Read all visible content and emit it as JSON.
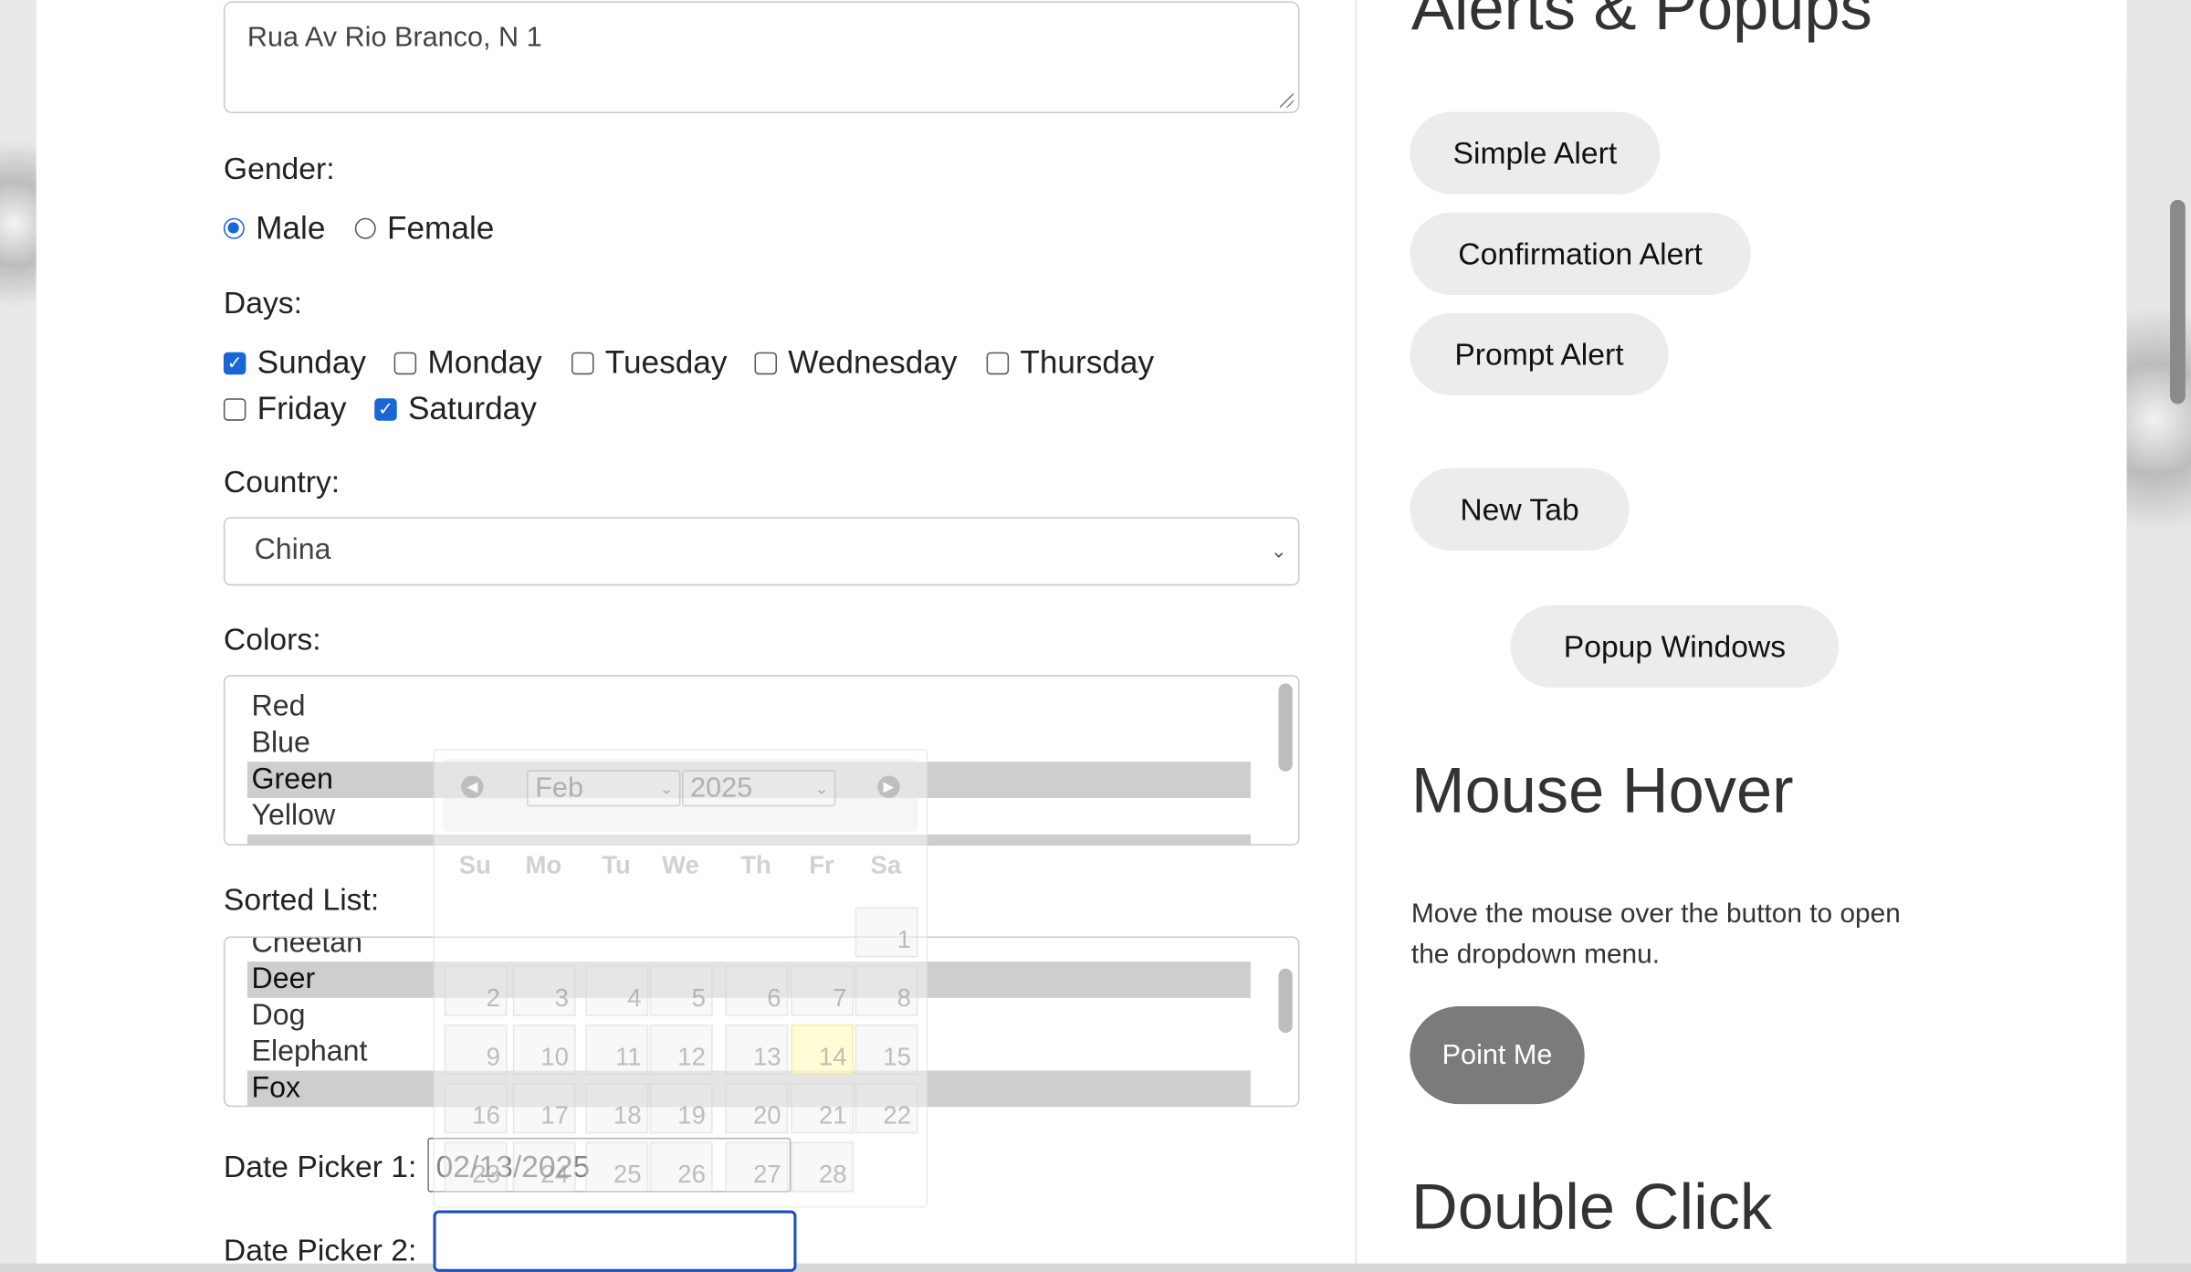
{
  "address": {
    "value": "Rua Av Rio Branco, N 1"
  },
  "gender": {
    "label": "Gender:",
    "options": [
      {
        "label": "Male",
        "checked": true
      },
      {
        "label": "Female",
        "checked": false
      }
    ]
  },
  "days": {
    "label": "Days:",
    "options": [
      {
        "label": "Sunday",
        "checked": true
      },
      {
        "label": "Monday",
        "checked": false
      },
      {
        "label": "Tuesday",
        "checked": false
      },
      {
        "label": "Wednesday",
        "checked": false
      },
      {
        "label": "Thursday",
        "checked": false
      },
      {
        "label": "Friday",
        "checked": false
      },
      {
        "label": "Saturday",
        "checked": true
      }
    ]
  },
  "country": {
    "label": "Country:",
    "selected": "China"
  },
  "colors": {
    "label": "Colors:",
    "items": [
      "Red",
      "Blue",
      "Green",
      "Yellow"
    ],
    "selected": [
      "Green"
    ]
  },
  "sorted_list": {
    "label": "Sorted List:",
    "items": [
      "Cheetah",
      "Deer",
      "Dog",
      "Elephant",
      "Fox"
    ],
    "selected": [
      "Deer",
      "Fox"
    ]
  },
  "date_picker_1": {
    "label": "Date Picker 1:",
    "value": "02/13/2025"
  },
  "date_picker_2": {
    "label": "Date Picker 2:",
    "value": ""
  },
  "calendar": {
    "month": "Feb",
    "year": "2025",
    "weekdays": [
      "Su",
      "Mo",
      "Tu",
      "We",
      "Th",
      "Fr",
      "Sa"
    ],
    "weeks": [
      [
        "",
        "",
        "",
        "",
        "",
        "",
        "1"
      ],
      [
        "2",
        "3",
        "4",
        "5",
        "6",
        "7",
        "8"
      ],
      [
        "9",
        "10",
        "11",
        "12",
        "13",
        "14",
        "15"
      ],
      [
        "16",
        "17",
        "18",
        "19",
        "20",
        "21",
        "22"
      ],
      [
        "23",
        "24",
        "25",
        "26",
        "27",
        "28",
        ""
      ]
    ],
    "highlighted_day": "14"
  },
  "right": {
    "alerts_heading": "Alerts & Popups",
    "simple_alert": "Simple Alert",
    "confirmation_alert": "Confirmation Alert",
    "prompt_alert": "Prompt Alert",
    "new_tab": "New Tab",
    "popup_windows": "Popup Windows",
    "mouse_hover_heading": "Mouse Hover",
    "mouse_hover_text": "Move the mouse over the button to open the dropdown menu.",
    "point_me": "Point Me",
    "double_click_heading": "Double Click"
  },
  "colors_theme": {
    "accent": "#1a66d8",
    "button_bg": "#ececec",
    "point_me_bg": "#7b7b7b",
    "selection_bg": "#cecece"
  }
}
